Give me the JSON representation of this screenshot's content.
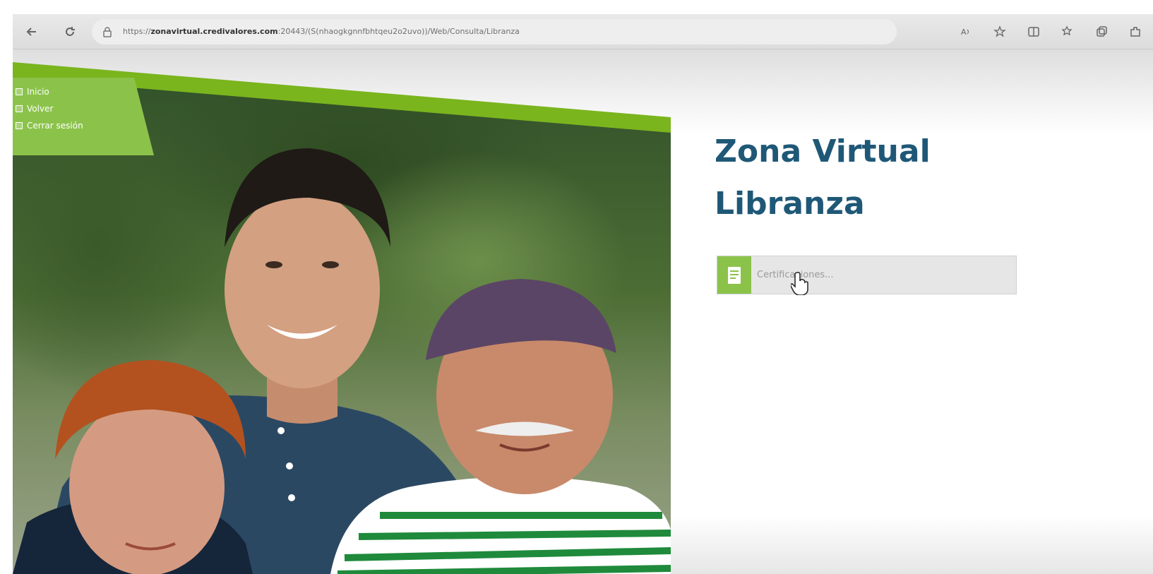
{
  "browser": {
    "url_prefix": "https://",
    "url_host": "zonavirtual.credivalores.com",
    "url_path": ":20443/(S(nhaogkgnnfbhtqeu2o2uvo))/Web/Consulta/Libranza"
  },
  "menu": {
    "items": [
      {
        "label": "Inicio"
      },
      {
        "label": "Volver"
      },
      {
        "label": "Cerrar sesión"
      }
    ]
  },
  "page": {
    "title_line1": "Zona Virtual",
    "title_line2": "Libranza",
    "cert_option_label": "Certificaciones..."
  },
  "colors": {
    "brand_green": "#8bc34a",
    "title_blue": "#1f5877"
  }
}
